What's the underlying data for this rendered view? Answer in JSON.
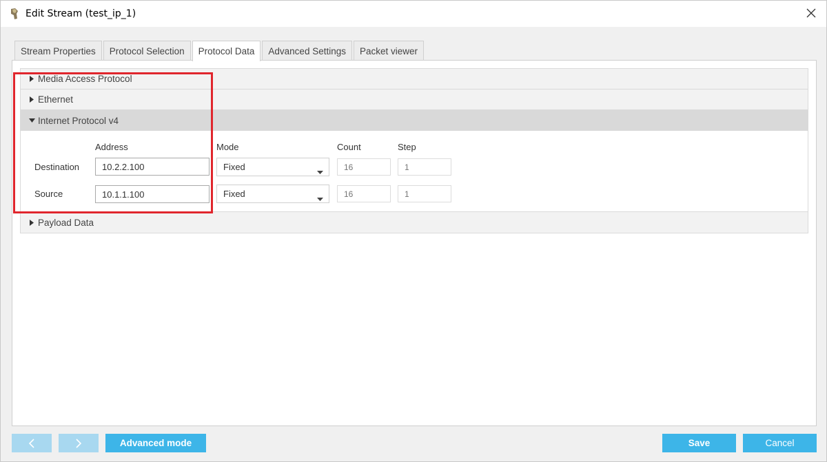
{
  "window": {
    "title": "Edit Stream (test_ip_1)"
  },
  "tabs": [
    {
      "label": "Stream Properties"
    },
    {
      "label": "Protocol Selection"
    },
    {
      "label": "Protocol Data"
    },
    {
      "label": "Advanced Settings"
    },
    {
      "label": "Packet viewer"
    }
  ],
  "active_tab": "Protocol Data",
  "sections": {
    "mac": "Media Access Protocol",
    "ethernet": "Ethernet",
    "ipv4": "Internet Protocol v4",
    "payload": "Payload Data"
  },
  "ipv4": {
    "columns": {
      "address": "Address",
      "mode": "Mode",
      "count": "Count",
      "step": "Step"
    },
    "destination": {
      "label": "Destination",
      "address": "10.2.2.100",
      "mode": "Fixed",
      "count": "16",
      "step": "1"
    },
    "source": {
      "label": "Source",
      "address": "10.1.1.100",
      "mode": "Fixed",
      "count": "16",
      "step": "1"
    }
  },
  "footer": {
    "advanced_mode": "Advanced mode",
    "save": "Save",
    "cancel": "Cancel"
  },
  "colors": {
    "accent": "#3db5e8",
    "accent_disabled": "#a8d8f0",
    "highlight": "#e0262d"
  },
  "icons": {
    "app": "app-icon",
    "close": "close-icon",
    "collapsed": "triangle-right-icon",
    "expanded": "triangle-down-icon",
    "dropdown": "caret-down-icon",
    "prev": "chevron-left-icon",
    "next": "chevron-right-icon"
  }
}
